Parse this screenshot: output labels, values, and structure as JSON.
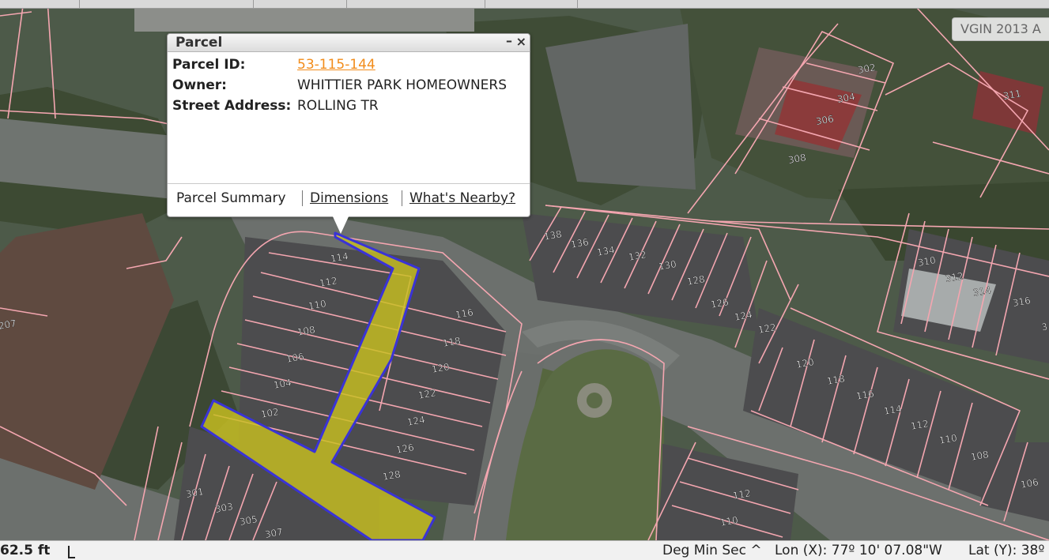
{
  "basemap": {
    "label": "VGIN 2013 A"
  },
  "popup": {
    "title": "Parcel",
    "fields": [
      {
        "label": "Parcel ID:",
        "value": "53-115-144"
      },
      {
        "label": "Owner:",
        "value": "WHITTIER PARK HOMEOWNERS"
      },
      {
        "label": "Street Address:",
        "value": "ROLLING TR"
      }
    ],
    "links": {
      "summary": "Parcel Summary",
      "dimensions": "Dimensions",
      "nearby": "What's Nearby?"
    }
  },
  "statusbar": {
    "scale": "62.5 ft",
    "coord_format": "Deg Min Sec ^",
    "lon": "Lon (X): 77º 10' 07.08\"W",
    "lat": "Lat (Y): 38º"
  },
  "lot_labels": [
    "114",
    "112",
    "110",
    "108",
    "106",
    "104",
    "102",
    "116",
    "118",
    "120",
    "122",
    "124",
    "126",
    "128",
    "138",
    "136",
    "134",
    "132",
    "130",
    "128",
    "126",
    "124",
    "122",
    "120",
    "118",
    "116",
    "114",
    "112",
    "110",
    "108",
    "106",
    "302",
    "304",
    "306",
    "308",
    "310",
    "312",
    "314",
    "316",
    "311",
    "301",
    "303",
    "305",
    "307",
    "112",
    "110",
    "207",
    "3"
  ],
  "colors": {
    "parcel_line": "#f4a6b0",
    "selected_fill": "#c8c020",
    "selected_outline": "#3a33d6"
  }
}
